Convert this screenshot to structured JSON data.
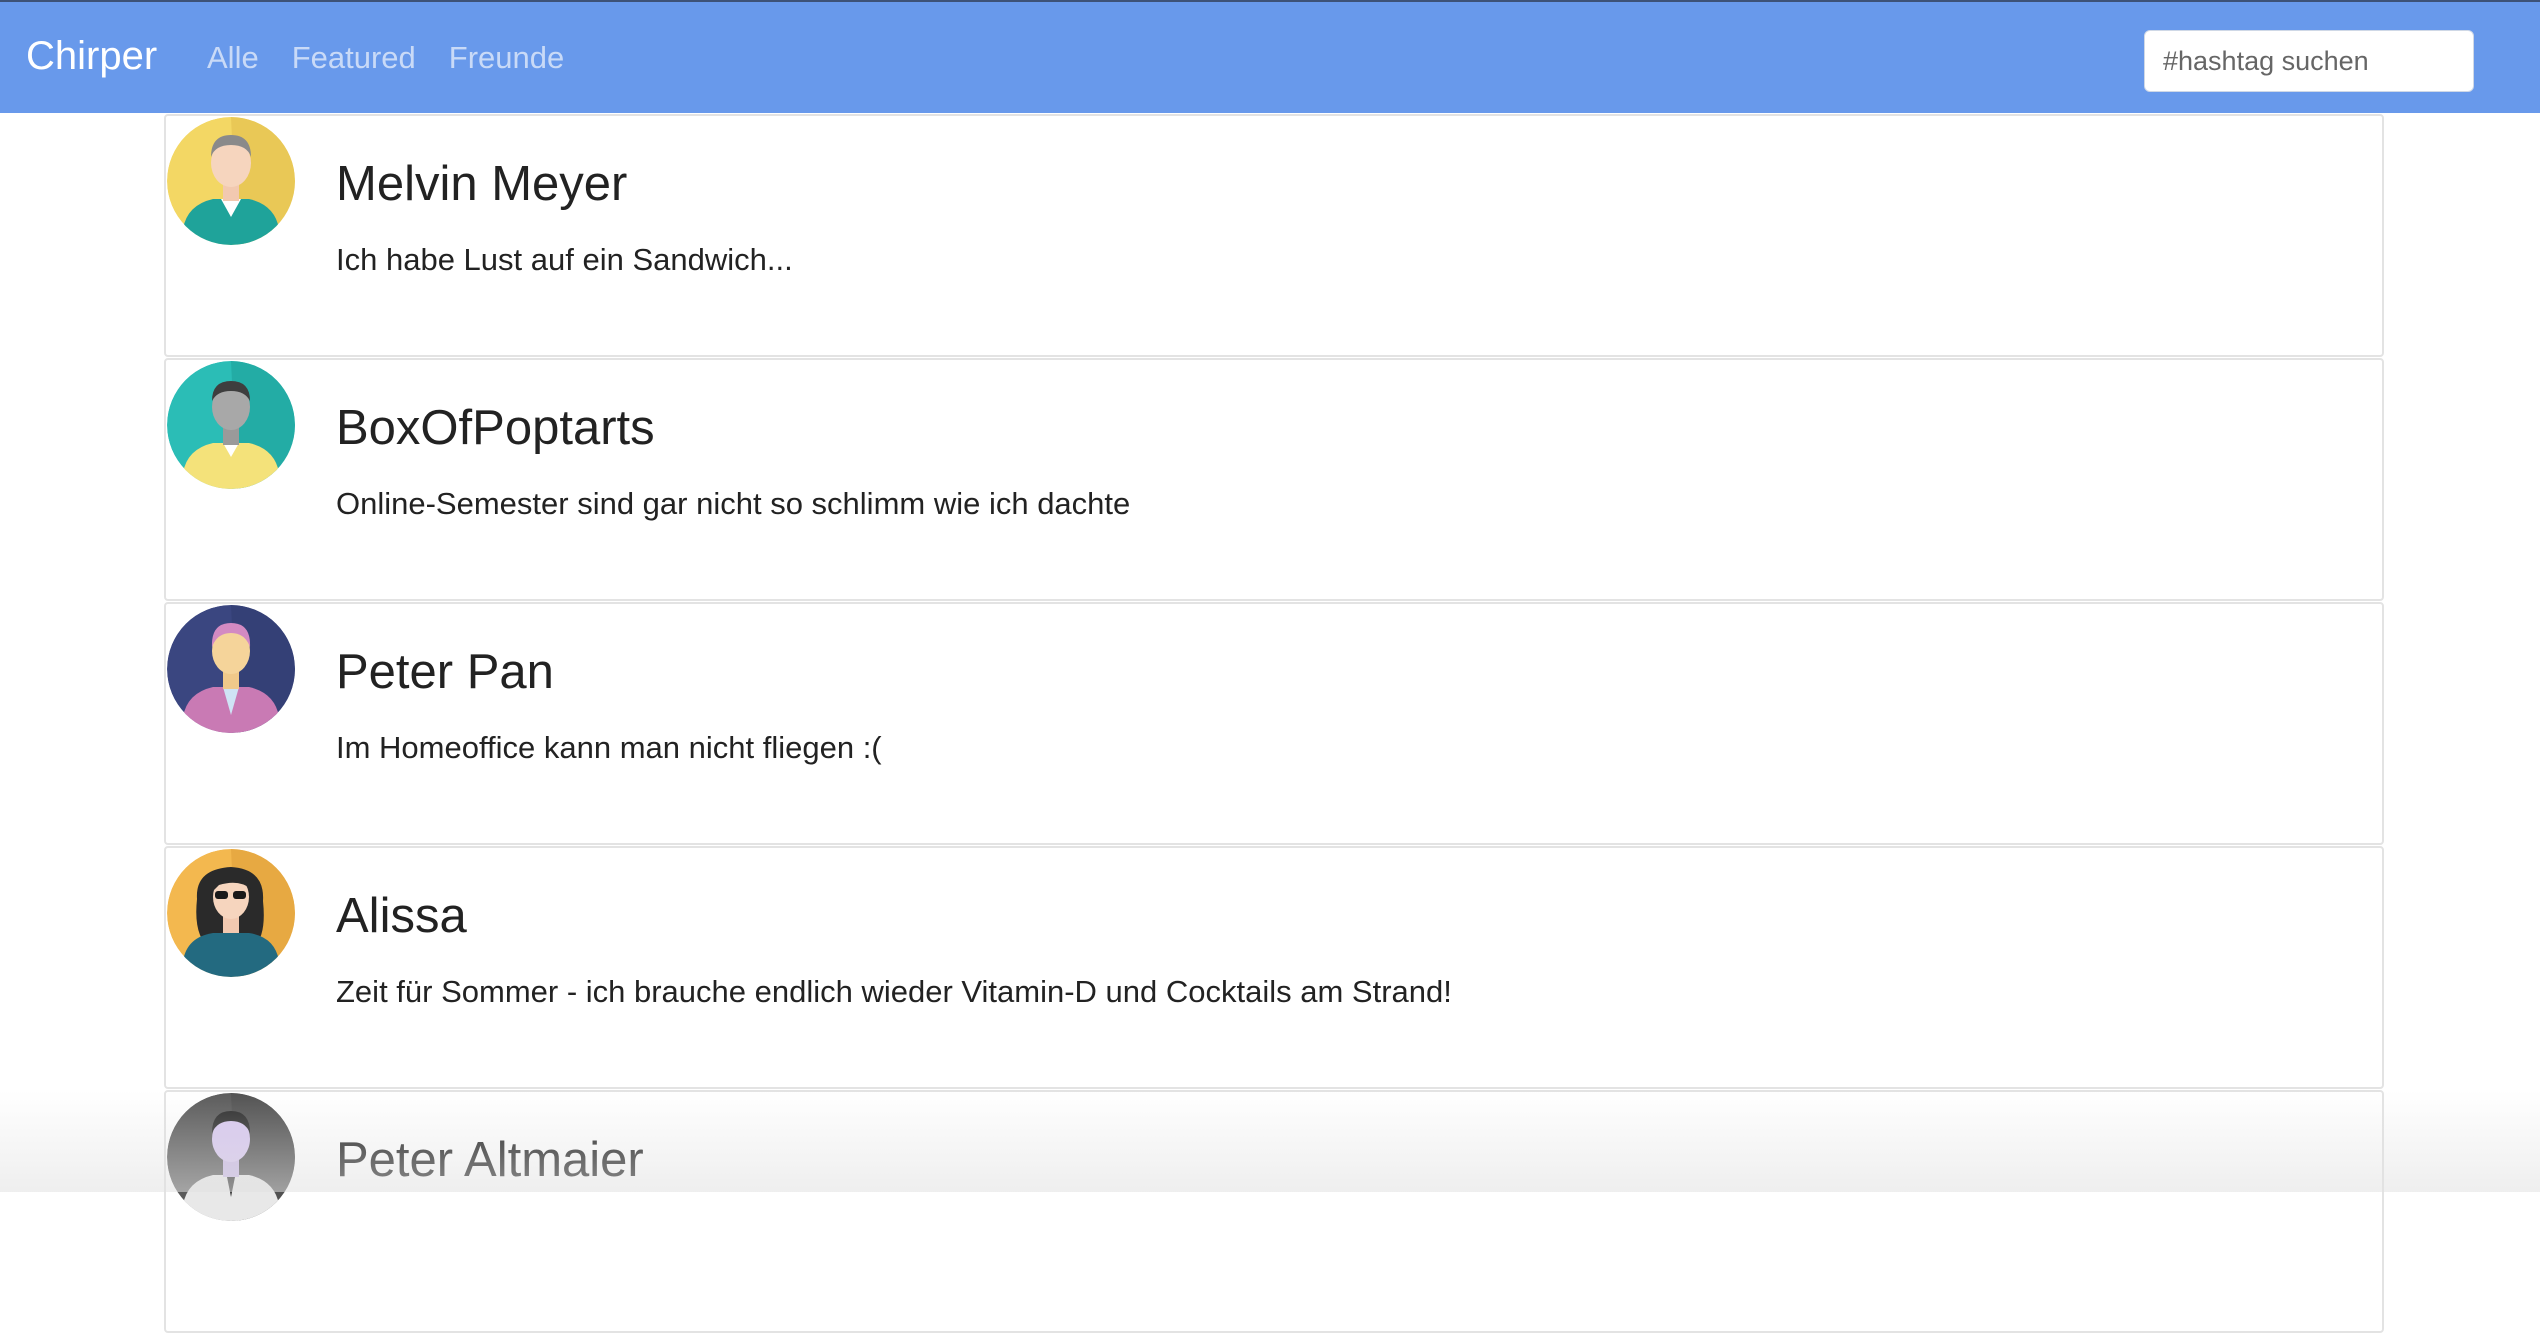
{
  "nav": {
    "brand": "Chirper",
    "links": [
      "Alle",
      "Featured",
      "Freunde"
    ],
    "search_placeholder": "#hashtag suchen"
  },
  "posts": [
    {
      "name": "Melvin Meyer",
      "text": "Ich habe Lust auf ein Sandwich...",
      "avatar": "man-teal-shirt-avatar-icon",
      "avatar_bg": "#f3d764"
    },
    {
      "name": "BoxOfPoptarts",
      "text": "Online-Semester sind gar nicht so schlimm wie ich dachte",
      "avatar": "man-yellow-shirt-avatar-icon",
      "avatar_bg": "#2bbdb6"
    },
    {
      "name": "Peter Pan",
      "text": "Im Homeoffice kann man nicht fliegen :(",
      "avatar": "person-pink-jacket-avatar-icon",
      "avatar_bg": "#3a4680"
    },
    {
      "name": "Alissa",
      "text": "Zeit für Sommer - ich brauche endlich wieder Vitamin-D und Cocktails am Strand!",
      "avatar": "woman-sunglasses-avatar-icon",
      "avatar_bg": "#f3b84f"
    },
    {
      "name": "Peter Altmaier",
      "text": "",
      "avatar": "man-suit-avatar-icon",
      "avatar_bg": "#5a5a5a"
    }
  ],
  "colors": {
    "navbar": "#6899eb",
    "brand_text": "#ffffff",
    "nav_link": "#c9daf7"
  }
}
